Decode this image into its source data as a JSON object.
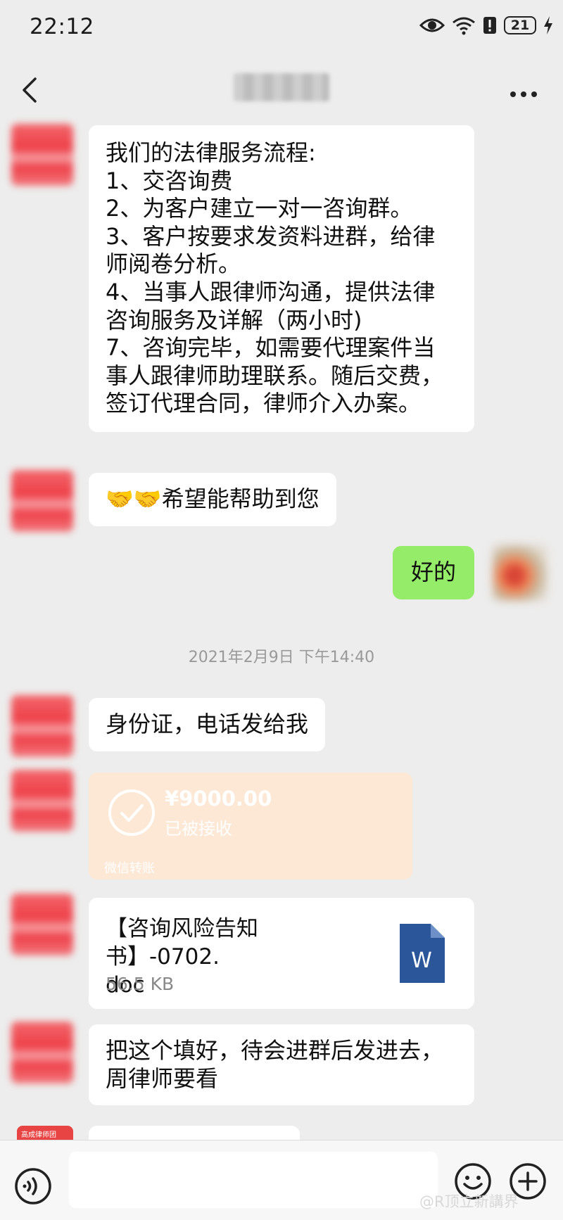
{
  "status_bar": {
    "time": "22:12",
    "battery": "21",
    "icons": [
      "eye-icon",
      "wifi-icon",
      "alert-icon",
      "battery-icon",
      "charging-icon"
    ]
  },
  "header": {
    "back_icon": "chevron-left-icon",
    "more_icon": "more-icon"
  },
  "messages": {
    "m1": "我们的法律服务流程:\n1、交咨询费\n2、为客户建立一对一咨询群。\n3、客户按要求发资料进群，给律\n师阅卷分析。\n4、当事人跟律师沟通，提供法律\n咨询服务及详解（两小时)\n7、咨询完毕，如需要代理案件当\n事人跟律师助理联系。随后交费，\n签订代理合同，律师介入办案。",
    "m2": "🤝🤝希望能帮助到您",
    "m3": "好的",
    "m4": "身份证，电话发给我",
    "m5": "把这个填好，待会进群后发进去，\n周律师要看"
  },
  "timestamp": "2021年2月9日 下午14:40",
  "transfer": {
    "amount": "¥9000.00",
    "status": "已被接收",
    "label": "微信转账"
  },
  "file": {
    "name": "【咨询风险告知书】-0702.\ndoc",
    "size": "56.5 KB",
    "icon_letter": "W"
  },
  "partial_avatar_text": "高成律师团",
  "input_bar": {
    "voice_icon": "voice-icon",
    "emoji_icon": "emoji-icon",
    "add_icon": "plus-icon"
  },
  "watermark": "@R顶立新講界",
  "colors": {
    "background": "#ededed",
    "bubble_other": "#ffffff",
    "bubble_self": "#95ec69",
    "transfer_bg": "#fde8d6",
    "word_blue": "#2b579a"
  }
}
